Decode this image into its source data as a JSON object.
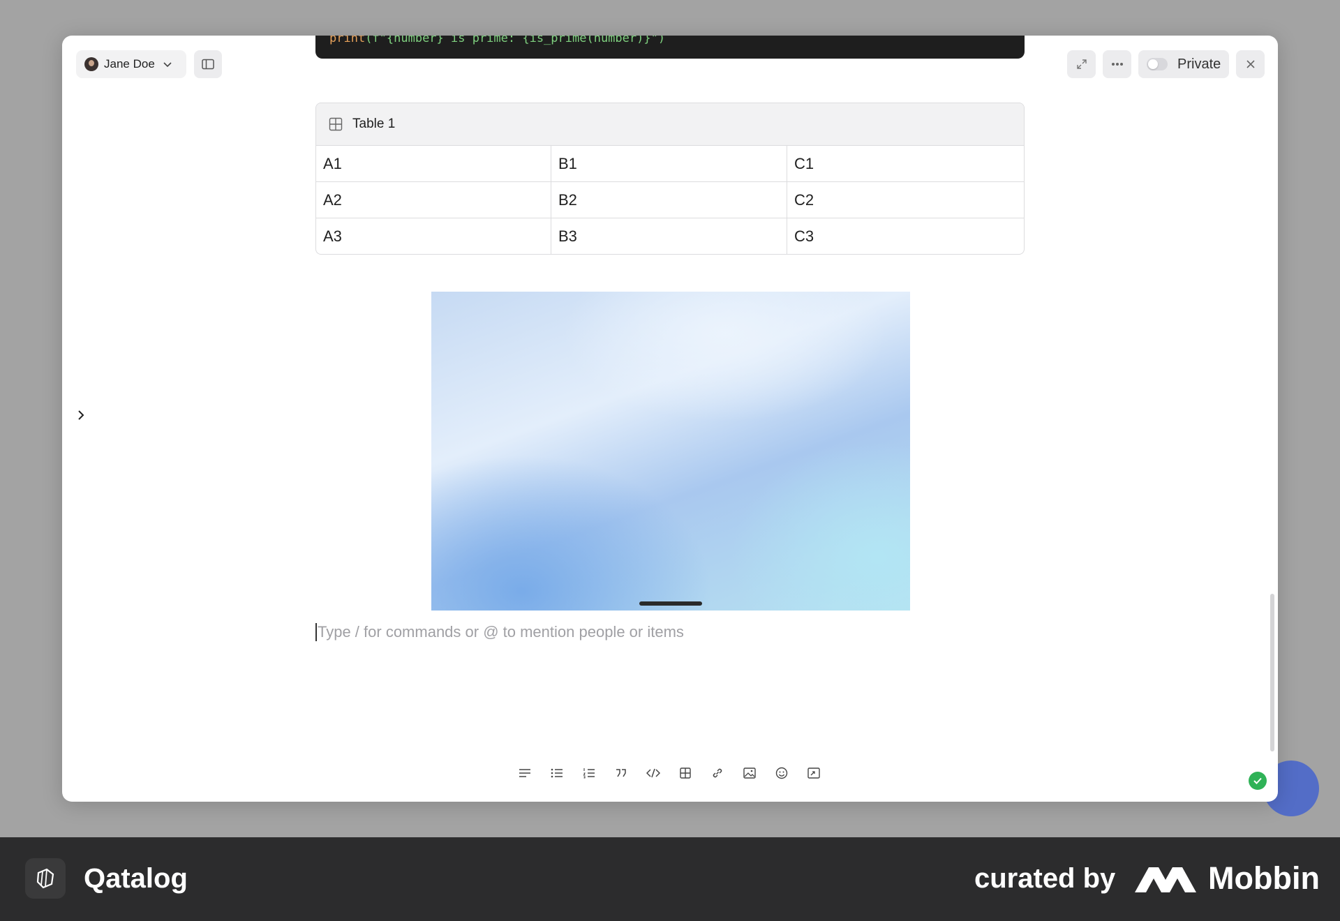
{
  "header": {
    "user_name": "Jane Doe",
    "visibility_label": "Private"
  },
  "code_block": {
    "line_keyword": "print",
    "line_rest": "(f\"{number} is prime: {is_prime(number)}\")"
  },
  "table": {
    "title": "Table 1",
    "rows": [
      [
        "A1",
        "B1",
        "C1"
      ],
      [
        "A2",
        "B2",
        "C2"
      ],
      [
        "A3",
        "B3",
        "C3"
      ]
    ]
  },
  "editor": {
    "placeholder": "Type / for commands or @ to mention people or items"
  },
  "toolbar": {
    "icons": [
      "paragraph-icon",
      "bullet-list-icon",
      "numbered-list-icon",
      "quote-icon",
      "code-icon",
      "table-icon",
      "link-icon",
      "image-icon",
      "emoji-icon",
      "embed-icon"
    ]
  },
  "footer": {
    "brand": "Qatalog",
    "curated_by": "curated by",
    "curator": "Mobbin"
  },
  "colors": {
    "status_ok": "#2fb257",
    "footer_bg": "#2c2c2d"
  }
}
